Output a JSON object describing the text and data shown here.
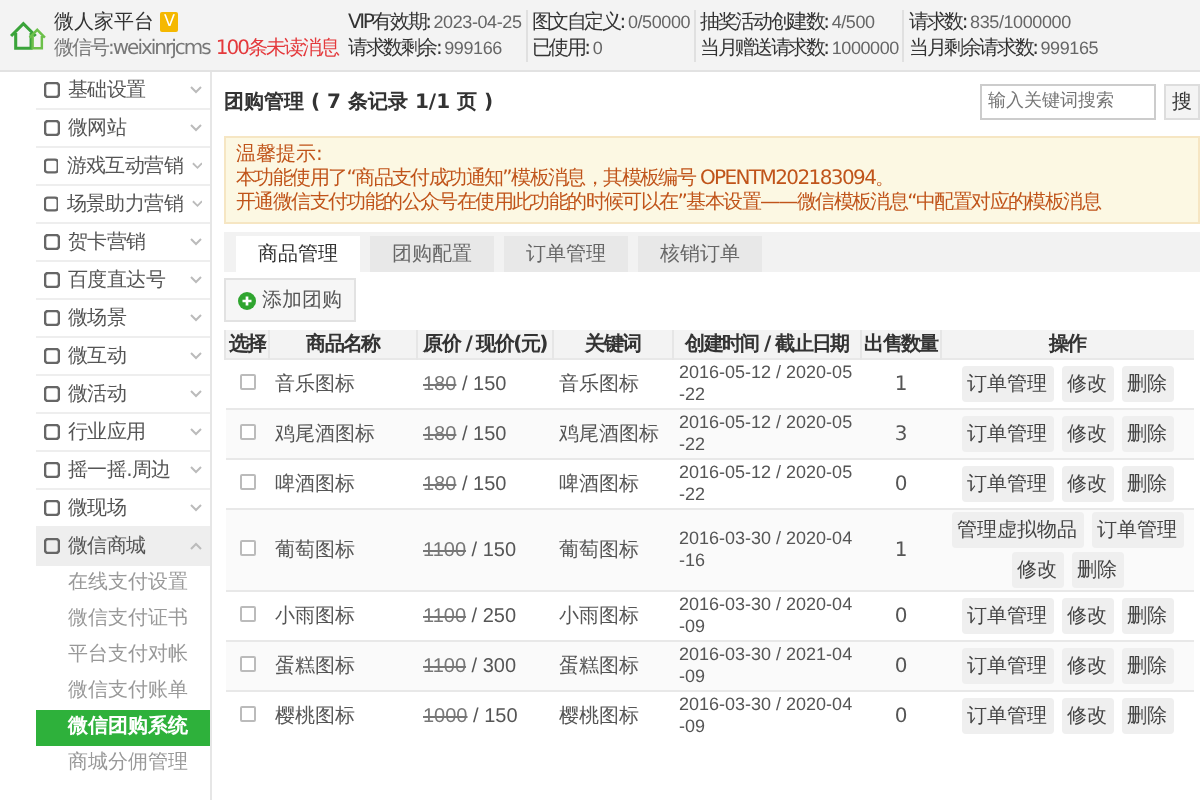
{
  "header": {
    "brand": "微人家平台",
    "badge": "V",
    "account": "微信号:weixinrjcms",
    "unread": "100条未读消息",
    "stats": [
      {
        "label": "VIP有效期:",
        "value": "2023-04-25"
      },
      {
        "label": "请求数剩余:",
        "value": "999166"
      },
      {
        "label": "图文自定义:",
        "value": "0/50000"
      },
      {
        "label": "已使用:",
        "value": "0"
      },
      {
        "label": "抽奖活动创建数:",
        "value": "4/500"
      },
      {
        "label": "当月赠送请求数:",
        "value": "1000000"
      },
      {
        "label": "请求数:",
        "value": "835/1000000"
      },
      {
        "label": "当月剩余请求数:",
        "value": "999165"
      }
    ]
  },
  "sidebar": {
    "items": [
      {
        "label": "基础设置",
        "expanded": false
      },
      {
        "label": "微网站",
        "expanded": false
      },
      {
        "label": "游戏互动营销",
        "expanded": false
      },
      {
        "label": "场景助力营销",
        "expanded": false
      },
      {
        "label": "贺卡营销",
        "expanded": false
      },
      {
        "label": "百度直达号",
        "expanded": false
      },
      {
        "label": "微场景",
        "expanded": false
      },
      {
        "label": "微互动",
        "expanded": false
      },
      {
        "label": "微活动",
        "expanded": false
      },
      {
        "label": "行业应用",
        "expanded": false
      },
      {
        "label": "摇一摇.周边",
        "expanded": false
      },
      {
        "label": "微现场",
        "expanded": false
      },
      {
        "label": "微信商城",
        "expanded": true,
        "children": [
          {
            "label": "在线支付设置",
            "selected": false
          },
          {
            "label": "微信支付证书",
            "selected": false
          },
          {
            "label": "平台支付对帐",
            "selected": false
          },
          {
            "label": "微信支付账单",
            "selected": false
          },
          {
            "label": "微信团购系统",
            "selected": true
          },
          {
            "label": "商城分佣管理",
            "selected": false
          }
        ]
      }
    ]
  },
  "page": {
    "title": "团购管理 ( 7 条记录 1/1 页 )",
    "search": {
      "placeholder": "输入关键词搜索",
      "button": "搜"
    }
  },
  "notice": {
    "title": "温馨提示:",
    "lines": [
      "本功能使用了“商品支付成功通知”模板消息，其模板编号 OPENTM202183094。",
      "开通微信支付功能的公众号在使用此功能的时候可以在”基本设置——微信模板消息“中配置对应的模板消息"
    ]
  },
  "tabs": [
    {
      "label": "商品管理",
      "selected": true
    },
    {
      "label": "团购配置",
      "selected": false
    },
    {
      "label": "订单管理",
      "selected": false
    },
    {
      "label": "核销订单",
      "selected": false
    }
  ],
  "add_button": "添加团购",
  "table": {
    "columns": [
      "选择",
      "商品名称",
      "原价 / 现价(元)",
      "关键词",
      "创建时间 / 截止日期",
      "出售数量",
      "操作"
    ],
    "rows": [
      {
        "checked": false,
        "name": "音乐图标",
        "original": "180",
        "current": "/ 150",
        "keyword": "音乐图标",
        "dates": "2016-05-12 / 2020-05-22",
        "sold": "1",
        "actions": [
          "订单管理",
          "修改",
          "删除"
        ]
      },
      {
        "checked": false,
        "name": "鸡尾酒图标",
        "original": "180",
        "current": "/ 150",
        "keyword": "鸡尾酒图标",
        "dates": "2016-05-12 / 2020-05-22",
        "sold": "3",
        "actions": [
          "订单管理",
          "修改",
          "删除"
        ]
      },
      {
        "checked": false,
        "name": "啤酒图标",
        "original": "180",
        "current": "/ 150",
        "keyword": "啤酒图标",
        "dates": "2016-05-12 / 2020-05-22",
        "sold": "0",
        "actions": [
          "订单管理",
          "修改",
          "删除"
        ]
      },
      {
        "checked": false,
        "name": "葡萄图标",
        "original": "1100",
        "current": "/ 150",
        "keyword": "葡萄图标",
        "dates": "2016-03-30 / 2020-04-16",
        "sold": "1",
        "actions": [
          "管理虚拟物品",
          "订单管理",
          "修改",
          "删除"
        ]
      },
      {
        "checked": false,
        "name": "小雨图标",
        "original": "1100",
        "current": "/ 250",
        "keyword": "小雨图标",
        "dates": "2016-03-30 / 2020-04-09",
        "sold": "0",
        "actions": [
          "订单管理",
          "修改",
          "删除"
        ]
      },
      {
        "checked": false,
        "name": "蛋糕图标",
        "original": "1100",
        "current": "/ 300",
        "keyword": "蛋糕图标",
        "dates": "2016-03-30 / 2021-04-09",
        "sold": "0",
        "actions": [
          "订单管理",
          "修改",
          "删除"
        ]
      },
      {
        "checked": false,
        "name": "樱桃图标",
        "original": "1000",
        "current": "/ 150",
        "keyword": "樱桃图标",
        "dates": "2016-03-30 / 2020-04-09",
        "sold": "0",
        "actions": [
          "订单管理",
          "修改",
          "删除"
        ]
      }
    ]
  }
}
